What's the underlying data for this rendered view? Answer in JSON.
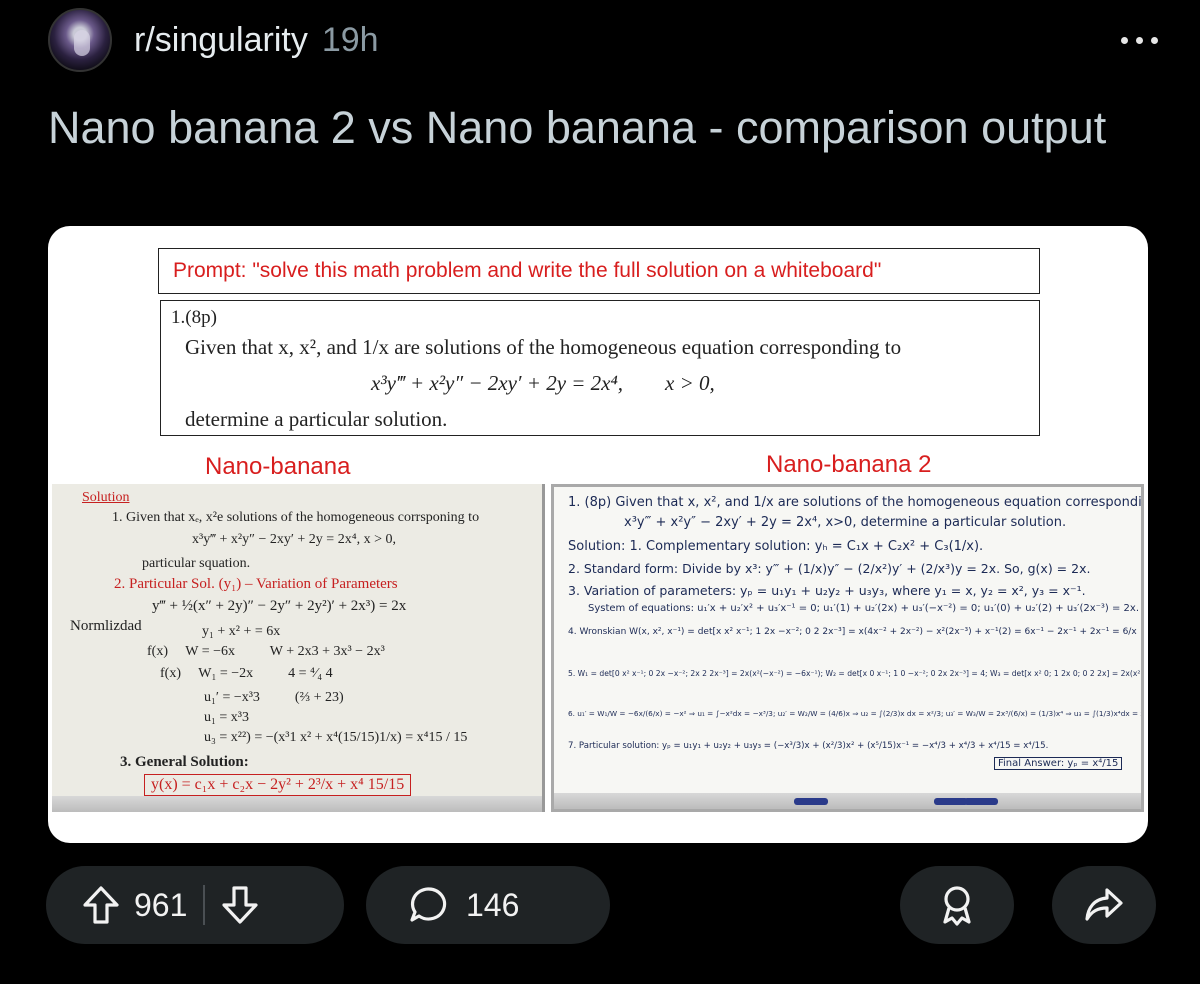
{
  "post": {
    "subreddit": "r/singularity",
    "age": "19h",
    "title": "Nano banana 2 vs Nano banana - comparison output"
  },
  "image": {
    "prompt": "Prompt: \"solve this math problem and write the full solution on a whiteboard\"",
    "problem": {
      "number": "1.(8p)",
      "line1": "Given that x, x², and 1/x are solutions of the homogeneous equation corresponding to",
      "equation": "x³y‴ + x²y″ − 2xy′ + 2y = 2x⁴,        x > 0,",
      "line2": "determine a particular solution."
    },
    "label_left": "Nano-banana",
    "label_right": "Nano-banana 2",
    "left_board": [
      "Solution",
      "1. Given that xₑ, x²e solutions of the homogeneous corrsponing to",
      "x³y‴ + x²y″ − 2xy′ + 2y = 2x⁴,        x > 0,",
      "particular squation.",
      "2. Particular Sol. (y₁) – Variation of Parameters",
      "y‴ + ½(x″ + 2y)″ − 2y″ + 2y²)′ + 2x³) = 2x",
      "Normlizdad",
      "y₁ + x² + = 6x",
      "f(x)     W = −6x          W + 2x3 + 3x³ − 2x³",
      "f(x)     W₁ = −2x          4 = ⁴⁄₄ 4",
      "u₁′ = −x³3          (⅔ + 23)",
      "u₁ = x³3",
      "u₃ = x²²) = −(x³1 x² + x⁴(15/15)1/x) = x⁴15 / 15",
      "3. General Solution:",
      "y(x) = c₁x + c₂x − 2y² + 2³/x + x⁴ 15/15"
    ],
    "right_board": [
      "1. (8p) Given that x, x², and 1/x are solutions of the homogeneous equation corresponding to",
      "x³y‴ + x²y″ − 2xy′ + 2y = 2x⁴, x>0, determine a particular solution.",
      "Solution: 1. Complementary solution: yₕ = C₁x + C₂x² + C₃(1/x).",
      "2. Standard form: Divide by x³: y‴ + (1/x)y″ − (2/x²)y′ + (2/x³)y = 2x. So, g(x) = 2x.",
      "3. Variation of parameters: yₚ = u₁y₁ + u₂y₂ + u₃y₃, where y₁ = x, y₂ = x², y₃ = x⁻¹.",
      "System of equations: u₁′x + u₂′x² + u₃′x⁻¹ = 0; u₁′(1) + u₂′(2x) + u₃′(−x⁻²) = 0; u₁′(0) + u₂′(2) + u₃′(2x⁻³) = 2x.",
      "4. Wronskian W(x, x², x⁻¹) = det[x x² x⁻¹; 1 2x −x⁻²; 0 2 2x⁻³] = x(4x⁻² + 2x⁻²) − x²(2x⁻³) + x⁻¹(2) = 6x⁻¹ − 2x⁻¹ + 2x⁻¹ = 6/x",
      "5. W₁ = det[0 x² x⁻¹; 0 2x −x⁻²; 2x 2 2x⁻³] = 2x(x²(−x⁻²) = −6x⁻¹); W₂ = det[x 0 x⁻¹; 1 0 −x⁻²; 0 2x 2x⁻³] = 4; W₃ = det[x x² 0; 1 2x 0; 0 2 2x] = 2x(x²) = 2x³",
      "6. u₁′ = W₁/W = −6x/(6/x) = −x² ⇒ u₁ = ∫−x²dx = −x³/3; u₂′ = W₂/W = (4/6)x ⇒ u₂ = ∫(2/3)x dx = x²/3; u₃′ = W₃/W = 2x³/(6/x) = (1/3)x⁴ ⇒ u₃ = ∫(1/3)x⁴dx = x⁵/15",
      "7. Particular solution: yₚ = u₁y₁ + u₂y₂ + u₃y₃ = (−x³/3)x + (x²/3)x² + (x⁵/15)x⁻¹ = −x⁴/3 + x⁴/3 + x⁴/15 = x⁴/15.",
      "Final Answer: yₚ = x⁴/15"
    ]
  },
  "actions": {
    "upvotes": "961",
    "comments": "146"
  },
  "icons": {
    "more": "more-horizontal-icon",
    "upvote": "arrow-up-icon",
    "downvote": "arrow-down-icon",
    "comment": "speech-bubble-icon",
    "award": "award-ribbon-icon",
    "share": "share-arrow-icon"
  }
}
